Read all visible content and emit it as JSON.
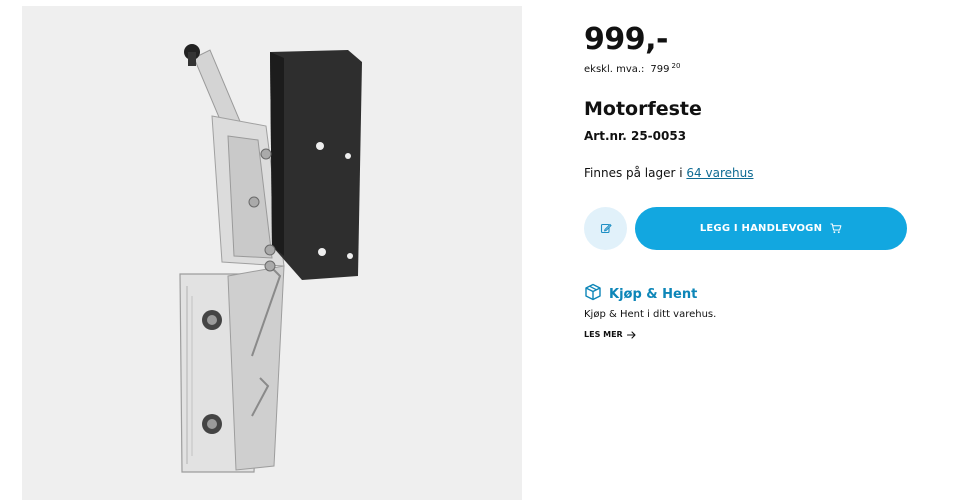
{
  "product": {
    "price": "999,-",
    "ex_vat_label": "ekskl. mva.:",
    "ex_vat_value": "799",
    "ex_vat_cents": "20",
    "title": "Motorfeste",
    "art_nr": "Art.nr. 25-0053",
    "stock_prefix": "Finnes på lager i",
    "stock_link": "64 varehus"
  },
  "actions": {
    "note_icon": "edit-icon",
    "add_to_cart_label": "LEGG I HANDLEVOGN",
    "cart_icon": "cart-icon"
  },
  "pickup": {
    "icon": "box-icon",
    "title": "Kjøp & Hent",
    "description": "Kjøp & Hent i ditt varehus.",
    "read_more": "LES MER"
  },
  "colors": {
    "accent": "#12a7e0",
    "accent_light": "#e1f1fa",
    "link": "#0f6b93",
    "pickup_title": "#0d86b8"
  }
}
